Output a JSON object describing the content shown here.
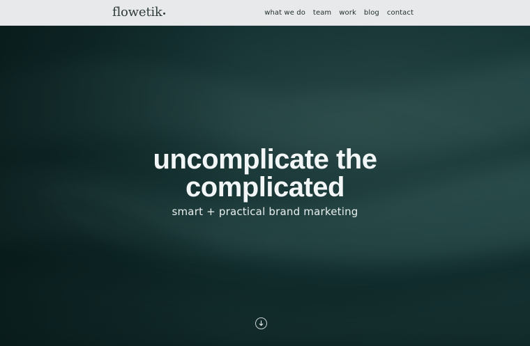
{
  "brand": {
    "logo_text": "flowetik"
  },
  "nav": {
    "links": [
      "what we do",
      "team",
      "work",
      "blog",
      "contact"
    ]
  },
  "hero": {
    "headline_line1": "uncomplicate the",
    "headline_line2": "complicated",
    "subhead": "smart + practical brand marketing",
    "scroll_icon": "arrow-down-circle-icon"
  },
  "colors": {
    "nav_bg": "#e8e9ea",
    "hero_bg": "#183737",
    "text_light": "#f3f6f6",
    "text_dark": "#1e2b2b"
  }
}
